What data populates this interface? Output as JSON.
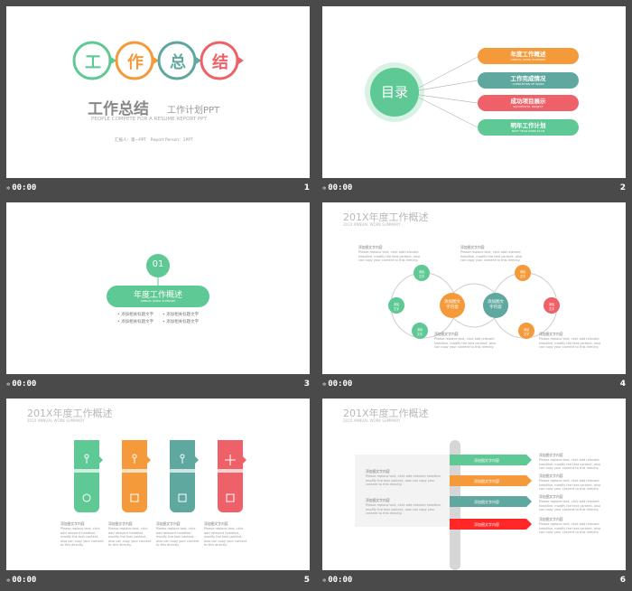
{
  "colors": {
    "green": "#5ec994",
    "orange": "#f59a3a",
    "teal": "#5fa89f",
    "red": "#ef6168"
  },
  "slides": [
    {
      "number": "1",
      "time": "00:00",
      "circles": [
        "工",
        "作",
        "总",
        "结"
      ],
      "title_main": "工作总结",
      "title_side": "工作计划PPT",
      "subtitle": "PEOPLE COMPETE FOR A RESUME REPORT PPT",
      "reporter": "汇报人：第一PPT　Report Person：1PPT"
    },
    {
      "number": "2",
      "time": "00:00",
      "toc_label": "目录",
      "items": [
        {
          "title": "年度工作概述",
          "sub": "ANNUAL WORK SUMMARY"
        },
        {
          "title": "工作完成情况",
          "sub": "COMPLETION OF WORK"
        },
        {
          "title": "成功项目展示",
          "sub": "SUCCESSFUL PROJECT"
        },
        {
          "title": "明年工作计划",
          "sub": "NEXT YEAR WORK PLAN"
        }
      ]
    },
    {
      "number": "3",
      "time": "00:00",
      "section_no": "01",
      "section_title": "年度工作概述",
      "section_sub": "ANNUAL WORK SUMMARY",
      "bullets": [
        "添加相关标题文字",
        "添加相关标题文字",
        "添加相关标题文字",
        "添加相关标题文字"
      ]
    },
    {
      "number": "4",
      "time": "00:00",
      "title": "201X年度工作概述",
      "sub": "201X ANNUAL WORK SUMMARY",
      "center_labels": [
        "添加图文\n字内容",
        "添加图文\n字内容"
      ],
      "small_label": "添加\n文字",
      "text_heading": "添加图文字内容",
      "text_body": "Please replace text, click add relevant headline, modify the text content, also can copy your content to this directly."
    },
    {
      "number": "5",
      "time": "00:00",
      "title": "201X年度工作概述",
      "sub": "201X ANNUAL WORK SUMMARY",
      "text_heading": "添加图文字内容",
      "text_body": "Please replace text, click add relevant headline, modify the text content, also can copy your content to this directly."
    },
    {
      "number": "6",
      "time": "00:00",
      "title": "201X年度工作概述",
      "sub": "201X ANNUAL WORK SUMMARY",
      "arrow_label": "添加图文字内容",
      "text_heading": "添加图文字内容",
      "text_body": "Please replace text, click add relevant headline, modify the text content, also can copy your content to this directly."
    }
  ]
}
